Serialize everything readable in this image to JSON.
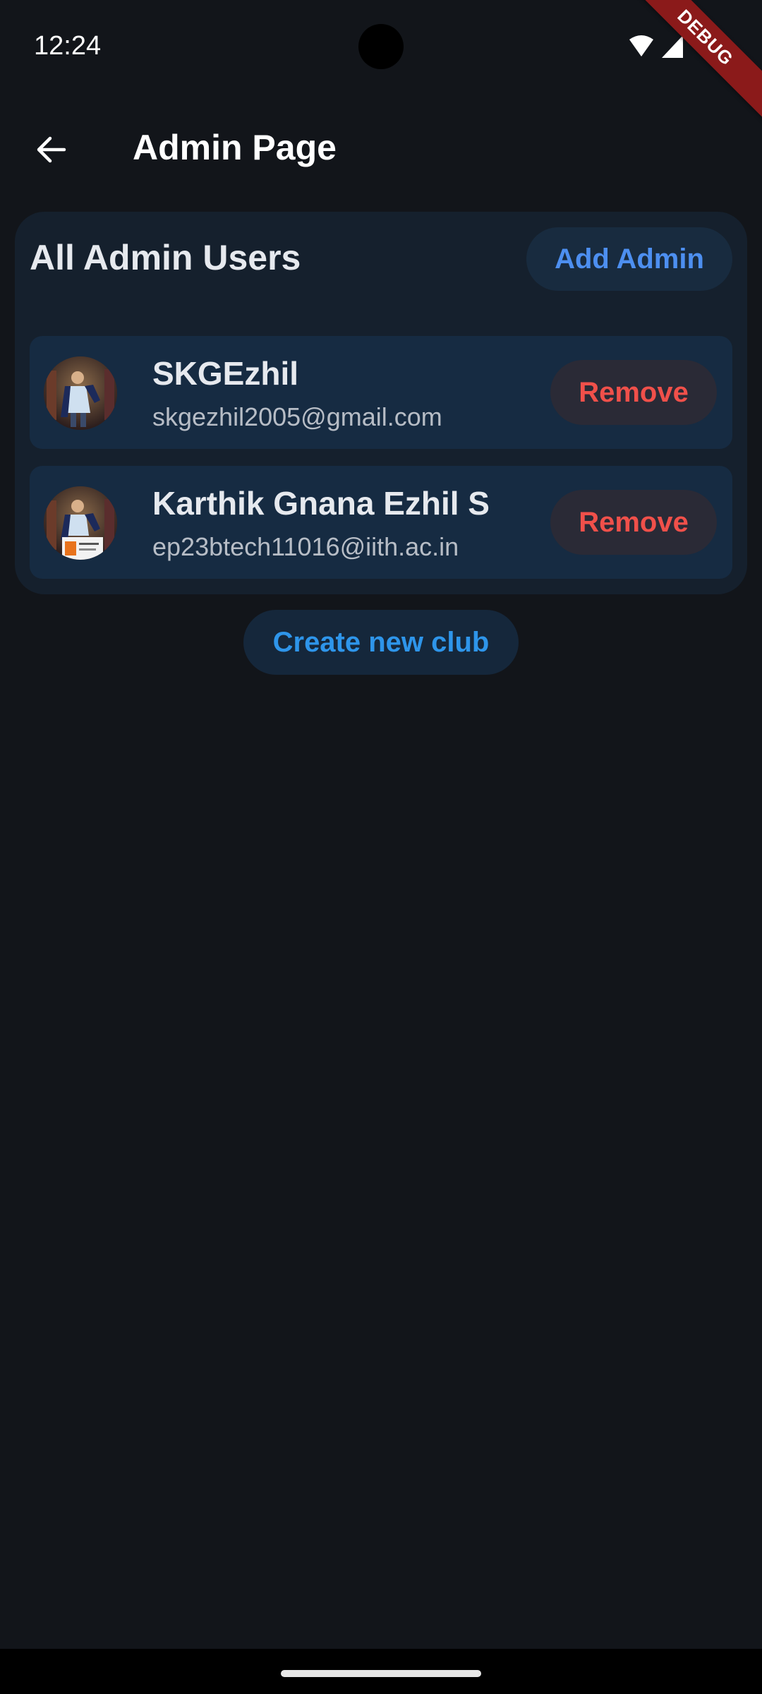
{
  "status_bar": {
    "time": "12:24",
    "icons": [
      "wifi-icon",
      "signal-icon"
    ]
  },
  "debug_banner": {
    "label": "DEBUG"
  },
  "app_bar": {
    "back_icon": "arrow-back-icon",
    "title": "Admin Page"
  },
  "admin_section": {
    "title": "All Admin Users",
    "add_button_label": "Add Admin",
    "users": [
      {
        "name": "SKGEzhil",
        "email": "skgezhil2005@gmail.com",
        "remove_label": "Remove"
      },
      {
        "name": "Karthik Gnana Ezhil S",
        "email": "ep23btech11016@iith.ac.in",
        "remove_label": "Remove"
      }
    ]
  },
  "create_club_label": "Create new club",
  "colors": {
    "background": "#12151a",
    "card": "#15202d",
    "row": "#162b42",
    "accent_blue": "#4d8ff0",
    "danger_red": "#f0504a",
    "debug_red": "#8b1a1a"
  }
}
